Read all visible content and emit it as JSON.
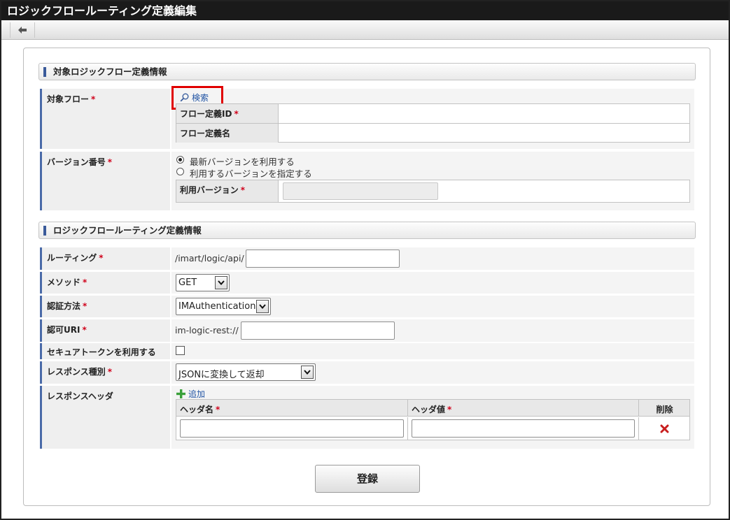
{
  "window": {
    "title": "ロジックフロールーティング定義編集"
  },
  "toolbar": {
    "back_icon": "back-arrow-icon"
  },
  "sections": {
    "target": "対象ロジックフロー定義情報",
    "routing": "ロジックフロールーティング定義情報"
  },
  "target_flow": {
    "label": "対象フロー",
    "required": "*",
    "search_label": "検索",
    "flow_id_label": "フロー定義ID",
    "flow_name_label": "フロー定義名",
    "flow_id_value": "",
    "flow_name_value": ""
  },
  "version": {
    "label": "バージョン番号",
    "required": "*",
    "option_latest": "最新バージョンを利用する",
    "option_specify": "利用するバージョンを指定する",
    "selected": "latest",
    "use_version_label": "利用バージョン",
    "use_version_value": ""
  },
  "routing": {
    "label": "ルーティング",
    "required": "*",
    "prefix": "/imart/logic/api/",
    "value": ""
  },
  "method": {
    "label": "メソッド",
    "required": "*",
    "selected": "GET"
  },
  "auth": {
    "label": "認証方法",
    "required": "*",
    "selected": "IMAuthentication"
  },
  "auth_uri": {
    "label": "認可URI",
    "required": "*",
    "prefix": "im-logic-rest://",
    "value": ""
  },
  "secure_token": {
    "label": "セキュアトークンを利用する",
    "checked": false
  },
  "response_type": {
    "label": "レスポンス種別",
    "required": "*",
    "selected": "JSONに変換して返却"
  },
  "response_header": {
    "label": "レスポンスヘッダ",
    "add_label": "追加",
    "col_name": "ヘッダ名",
    "col_value": "ヘッダ値",
    "col_delete": "削除",
    "required": "*",
    "rows": [
      {
        "name": "",
        "value": ""
      }
    ]
  },
  "actions": {
    "register_label": "登録"
  },
  "colors": {
    "accent": "#4a6aa8",
    "required": "#d0021b",
    "highlight": "#e00000",
    "link": "#2255a4"
  }
}
